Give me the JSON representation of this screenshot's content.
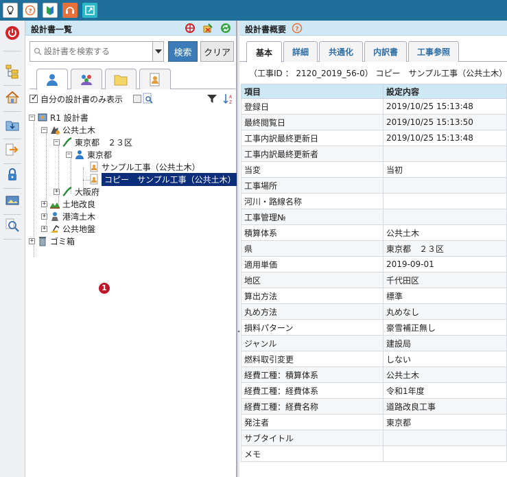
{
  "toolbar": {
    "buttons": [
      "lightbulb-icon",
      "help-icon",
      "beginner-mark-icon",
      "support-headset-icon",
      "expand-window-icon"
    ]
  },
  "leftbar": {
    "buttons": [
      "power-icon",
      "tree-view-icon",
      "home-icon",
      "download-folder-icon",
      "export-arrow-icon",
      "lock-icon",
      "photo-icon",
      "search-zoom-icon"
    ]
  },
  "tree_panel": {
    "title": "設計書一覧",
    "search_placeholder": "設計書を検索する",
    "search_button": "検索",
    "clear_button": "クリア",
    "own_only_label": "自分の設計書のみ表示",
    "own_only_checked": true
  },
  "tree": {
    "nodes": [
      {
        "label": "R1 設計書"
      },
      {
        "label": "公共土木"
      },
      {
        "label": "東京都　２３区"
      },
      {
        "label": "東京都"
      },
      {
        "label": "サンプル工事（公共土木）"
      },
      {
        "label": "コピー　サンプル工事（公共土木）",
        "selected": true,
        "badge": "1"
      },
      {
        "label": "大阪府"
      },
      {
        "label": "土地改良"
      },
      {
        "label": "港湾土木"
      },
      {
        "label": "公共地盤"
      },
      {
        "label": "ゴミ箱"
      }
    ]
  },
  "overview_panel": {
    "title": "設計書概要",
    "tabs": [
      {
        "label": "基本",
        "active": true
      },
      {
        "label": "詳細"
      },
      {
        "label": "共通化"
      },
      {
        "label": "内訳書"
      },
      {
        "label": "工事参照"
      }
    ],
    "doc_id": "（工事ID ： 2120_2019_56-0） コピー　サンプル工事（公共土木）",
    "columns": [
      "項目",
      "設定内容"
    ],
    "rows": [
      [
        "登録日",
        "2019/10/25 15:13:48"
      ],
      [
        "最終閲覧日",
        "2019/10/25 15:13:50"
      ],
      [
        "工事内訳最終更新日",
        "2019/10/25 15:13:48"
      ],
      [
        "工事内訳最終更新者",
        ""
      ],
      [
        "当変",
        "当初"
      ],
      [
        "工事場所",
        ""
      ],
      [
        "河川・路線名称",
        ""
      ],
      [
        "工事管理№",
        ""
      ],
      [
        "積算体系",
        "公共土木"
      ],
      [
        "県",
        "東京都　２３区"
      ],
      [
        "適用単価",
        "2019-09-01"
      ],
      [
        "地区",
        "千代田区"
      ],
      [
        "算出方法",
        "標準"
      ],
      [
        "丸め方法",
        "丸めなし"
      ],
      [
        "損料パターン",
        "豪雪補正無し"
      ],
      [
        "ジャンル",
        "建設局"
      ],
      [
        "燃料取引変更",
        "しない"
      ],
      [
        "経費工種：積算体系",
        "公共土木"
      ],
      [
        "経費工種：経費体系",
        "令和1年度"
      ],
      [
        "経費工種：経費名称",
        "道路改良工事"
      ],
      [
        "発注者",
        "東京都"
      ],
      [
        "サブタイトル",
        ""
      ],
      [
        "メモ",
        ""
      ]
    ]
  },
  "colors": {
    "topbar": "#1f6f9a",
    "header": "#cfe8f6",
    "accent": "#3a7bb8",
    "selected": "#0b2e7a",
    "badge": "#c0152a"
  }
}
